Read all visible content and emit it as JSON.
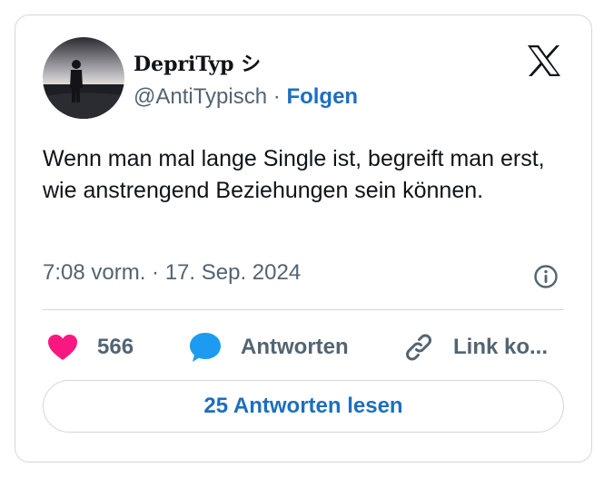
{
  "author": {
    "name": "DepriTyp シ",
    "handle": "@AntiTypisch",
    "separator": "·",
    "follow_label": "Folgen"
  },
  "tweet": {
    "text": "Wenn man mal lange Single ist, begreift man erst, wie anstrengend Beziehungen sein können.",
    "timestamp": "7:08 vorm. · 17. Sep. 2024"
  },
  "actions": {
    "like_count": "566",
    "reply_label": "Antworten",
    "copy_link_label": "Link ko..."
  },
  "read_replies_label": "25 Antworten lesen",
  "colors": {
    "accent": "#1d6fbf",
    "like": "#f91880",
    "reply": "#1d9bf0",
    "muted_text": "#536471",
    "border": "#cfd9de"
  },
  "icons": [
    "x-logo-icon",
    "info-icon",
    "heart-icon",
    "speech-bubble-icon",
    "link-icon"
  ]
}
